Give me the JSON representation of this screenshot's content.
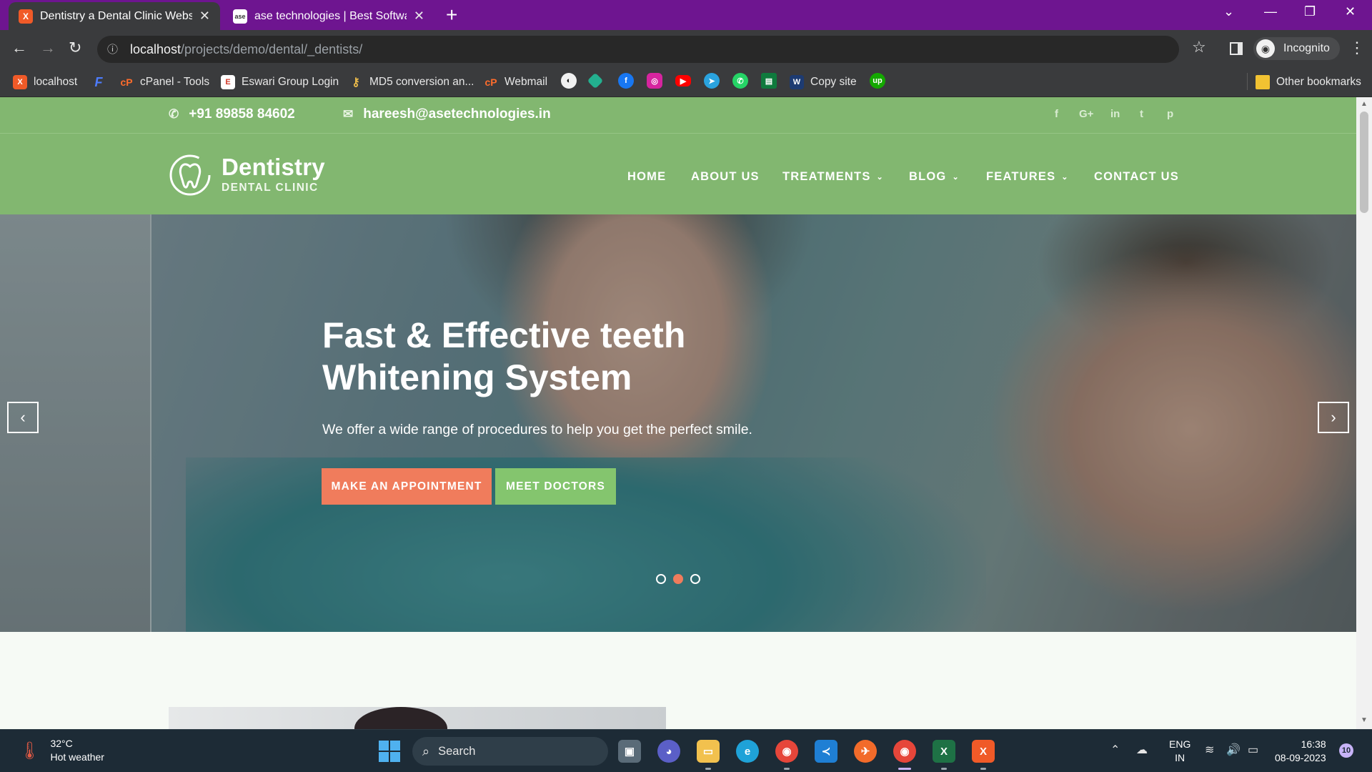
{
  "browser": {
    "tabs": [
      {
        "title": "Dentistry a Dental Clinic Website",
        "active": true,
        "favicon": "xampp-icon"
      },
      {
        "title": "ase technologies | Best Software",
        "active": false,
        "favicon": "ase-icon"
      }
    ],
    "url_host": "localhost",
    "url_path": "/projects/demo/dental/_dentists/",
    "profile_label": "Incognito",
    "bookmarks": [
      {
        "label": "localhost",
        "icon": "xampp-icon"
      },
      {
        "label": "",
        "icon": "f-icon"
      },
      {
        "label": "cPanel - Tools",
        "icon": "cpanel-icon"
      },
      {
        "label": "Eswari Group Login",
        "icon": "eswari-icon"
      },
      {
        "label": "MD5 conversion an...",
        "icon": "key-icon"
      },
      {
        "label": "Webmail",
        "icon": "cpanel-icon"
      },
      {
        "label": "Copy site",
        "icon": "copy-site-icon"
      }
    ],
    "other_bookmarks_label": "Other bookmarks"
  },
  "site": {
    "phone": "+91 89858 84602",
    "email": "hareesh@asetechnologies.in",
    "social": [
      "f",
      "G+",
      "in",
      "t",
      "p"
    ],
    "logo_title": "Dentistry",
    "logo_subtitle": "DENTAL CLINIC",
    "menu": [
      {
        "label": "HOME",
        "dropdown": false
      },
      {
        "label": "ABOUT US",
        "dropdown": false
      },
      {
        "label": "TREATMENTS",
        "dropdown": true
      },
      {
        "label": "BLOG",
        "dropdown": true
      },
      {
        "label": "FEATURES",
        "dropdown": true
      },
      {
        "label": "CONTACT US",
        "dropdown": false
      }
    ],
    "hero": {
      "title_line1": "Fast & Effective teeth",
      "title_line2": "Whitening System",
      "subtitle": "We offer a wide range of procedures to help you get the perfect smile.",
      "btn_appointment": "MAKE AN APPOINTMENT",
      "btn_doctors": "MEET DOCTORS",
      "slides": 3,
      "active_slide": 2
    },
    "colors": {
      "brand_green": "#82b770",
      "accent_orange": "#f07c5c",
      "button_green": "#84c56e"
    }
  },
  "taskbar": {
    "temperature": "32°C",
    "weather": "Hot weather",
    "search_label": "Search",
    "lang_line1": "ENG",
    "lang_line2": "IN",
    "time": "16:38",
    "date": "08-09-2023",
    "notifications": "10"
  }
}
